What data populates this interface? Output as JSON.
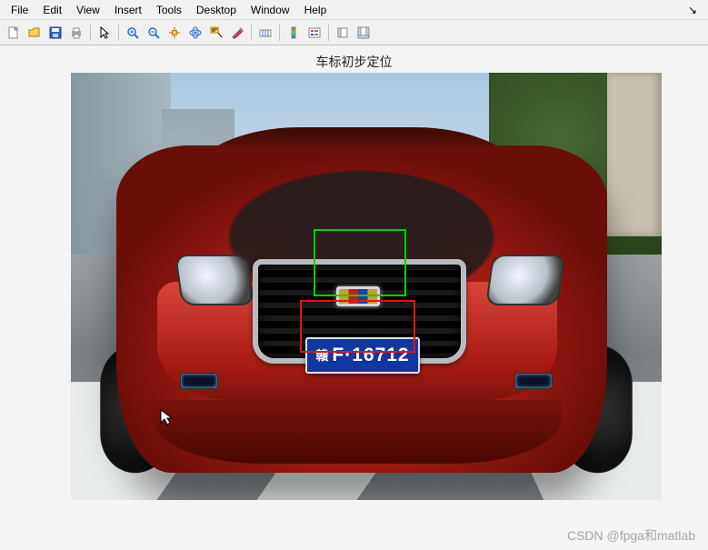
{
  "menubar": {
    "items": [
      "File",
      "Edit",
      "View",
      "Insert",
      "Tools",
      "Desktop",
      "Window",
      "Help"
    ],
    "extra": "↘"
  },
  "toolbar": {
    "icons": [
      {
        "name": "new-file-icon"
      },
      {
        "name": "open-file-icon"
      },
      {
        "name": "save-icon"
      },
      {
        "name": "print-icon"
      },
      {
        "sep": true
      },
      {
        "name": "pointer-icon"
      },
      {
        "sep": true
      },
      {
        "name": "zoom-in-icon"
      },
      {
        "name": "zoom-out-icon"
      },
      {
        "name": "pan-icon"
      },
      {
        "name": "rotate3d-icon"
      },
      {
        "name": "data-cursor-icon"
      },
      {
        "name": "brush-icon"
      },
      {
        "sep": true
      },
      {
        "name": "link-axes-icon"
      },
      {
        "sep": true
      },
      {
        "name": "insert-colorbar-icon"
      },
      {
        "name": "insert-legend-icon"
      },
      {
        "sep": true
      },
      {
        "name": "hide-plot-tools-icon"
      },
      {
        "name": "show-plot-tools-icon"
      }
    ]
  },
  "figure": {
    "title": "车标初步定位",
    "plate_prefix": "赣",
    "plate_text": "F·16712"
  },
  "detections": {
    "logo_box_color": "#00d000",
    "plate_box_color": "#f01010"
  },
  "watermark": "CSDN @fpga和matlab"
}
